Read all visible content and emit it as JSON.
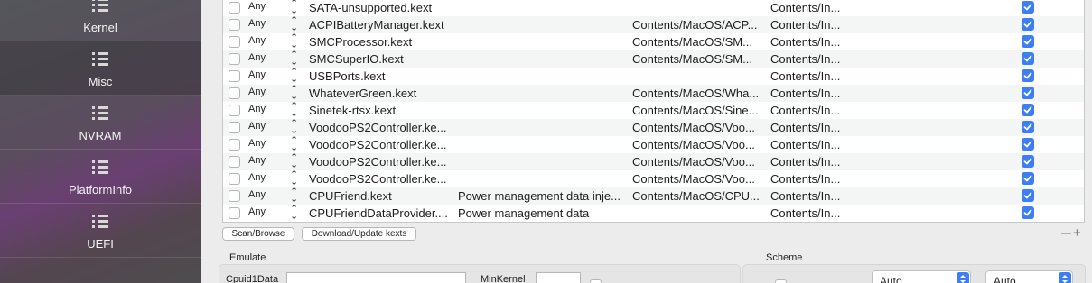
{
  "sidebar": {
    "items": [
      {
        "label": "Kernel",
        "icon": "list-icon",
        "active": false
      },
      {
        "label": "Misc",
        "icon": "list-icon",
        "active": true
      },
      {
        "label": "NVRAM",
        "icon": "list-icon",
        "active": false
      },
      {
        "label": "PlatformInfo",
        "icon": "list-icon",
        "active": false
      },
      {
        "label": "UEFI",
        "icon": "list-icon",
        "active": false
      }
    ]
  },
  "kext_table": {
    "rows": [
      {
        "arch": "Any",
        "name": "SATA-unsupported.kext",
        "comment": "",
        "executable": "",
        "plist": "Contents/In...",
        "enabled": true
      },
      {
        "arch": "Any",
        "name": "ACPIBatteryManager.kext",
        "comment": "",
        "executable": "Contents/MacOS/ACP...",
        "plist": "Contents/In...",
        "enabled": true
      },
      {
        "arch": "Any",
        "name": "SMCProcessor.kext",
        "comment": "",
        "executable": "Contents/MacOS/SM...",
        "plist": "Contents/In...",
        "enabled": true
      },
      {
        "arch": "Any",
        "name": "SMCSuperIO.kext",
        "comment": "",
        "executable": "Contents/MacOS/SM...",
        "plist": "Contents/In...",
        "enabled": true
      },
      {
        "arch": "Any",
        "name": "USBPorts.kext",
        "comment": "",
        "executable": "",
        "plist": "Contents/In...",
        "enabled": true
      },
      {
        "arch": "Any",
        "name": "WhateverGreen.kext",
        "comment": "",
        "executable": "Contents/MacOS/Wha...",
        "plist": "Contents/In...",
        "enabled": true
      },
      {
        "arch": "Any",
        "name": "Sinetek-rtsx.kext",
        "comment": "",
        "executable": "Contents/MacOS/Sine...",
        "plist": "Contents/In...",
        "enabled": true
      },
      {
        "arch": "Any",
        "name": "VoodooPS2Controller.ke...",
        "comment": "",
        "executable": "Contents/MacOS/Voo...",
        "plist": "Contents/In...",
        "enabled": true
      },
      {
        "arch": "Any",
        "name": "VoodooPS2Controller.ke...",
        "comment": "",
        "executable": "Contents/MacOS/Voo...",
        "plist": "Contents/In...",
        "enabled": true
      },
      {
        "arch": "Any",
        "name": "VoodooPS2Controller.ke...",
        "comment": "",
        "executable": "Contents/MacOS/Voo...",
        "plist": "Contents/In...",
        "enabled": true
      },
      {
        "arch": "Any",
        "name": "VoodooPS2Controller.ke...",
        "comment": "",
        "executable": "Contents/MacOS/Voo...",
        "plist": "Contents/In...",
        "enabled": true
      },
      {
        "arch": "Any",
        "name": "CPUFriend.kext",
        "comment": "Power management data inje...",
        "executable": "Contents/MacOS/CPU...",
        "plist": "Contents/In...",
        "enabled": true
      },
      {
        "arch": "Any",
        "name": "CPUFriendDataProvider....",
        "comment": "Power management data",
        "executable": "",
        "plist": "Contents/In...",
        "enabled": true
      }
    ]
  },
  "buttons": {
    "scan_browse": "Scan/Browse",
    "download_update": "Download/Update kexts",
    "remove": "—",
    "add": "+"
  },
  "emulate": {
    "title": "Emulate",
    "cpuid1data_label": "Cpuid1Data",
    "cpuid1data_value": "",
    "minkernel_label": "MinKernel",
    "minkernel_value": ""
  },
  "scheme": {
    "title": "Scheme",
    "popup1_value": "Auto",
    "popup2_value": "Auto"
  },
  "colors": {
    "accent": "#3d7ef7",
    "sidebar_purple": "#6a3f72"
  }
}
